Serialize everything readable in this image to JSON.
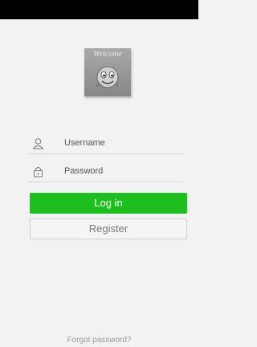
{
  "logo": {
    "text": "Welcome",
    "icon": "smiley-face-icon"
  },
  "form": {
    "username": {
      "placeholder": "Username",
      "icon": "user-icon"
    },
    "password": {
      "placeholder": "Password",
      "icon": "lock-icon"
    }
  },
  "buttons": {
    "login": "Log in",
    "register": "Register"
  },
  "links": {
    "forgot_password": "Forgot password?"
  },
  "colors": {
    "accent": "#1dbe1d",
    "status_bar": "#000000",
    "background": "#f2f2f2"
  }
}
